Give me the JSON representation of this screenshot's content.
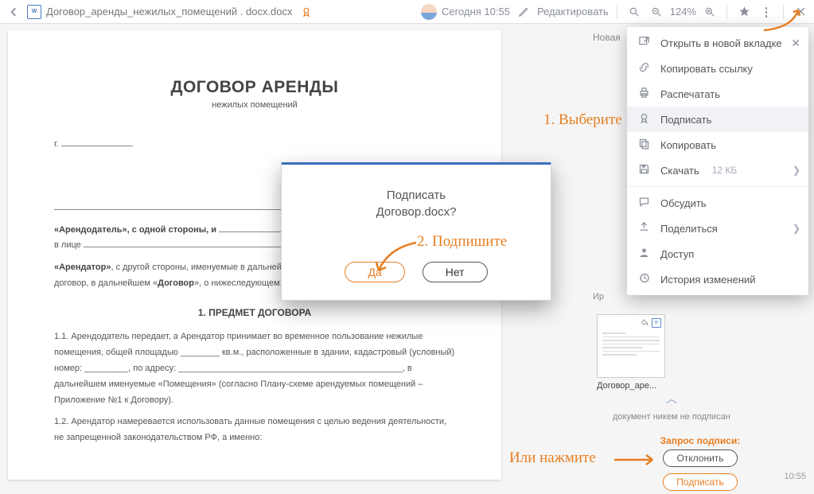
{
  "toolbar": {
    "doc_icon_text": "W",
    "title": "Договор_аренды_нежилых_помещений . docx.docx",
    "timestamp": "Сегодня 10:55",
    "edit_label": "Редактировать",
    "zoom": "124%"
  },
  "document": {
    "title": "ДОГОВОР АРЕНДЫ",
    "subtitle": "нежилых помещений",
    "city_prefix": "г.",
    "p1_a": "«Арендодатель», с одной стороны, и",
    "p1_b": "в лице",
    "p2": "«Арендатор», с другой стороны, именуемые в дальнейшем «Стороны», заключили настоящий договор, в дальнейшем «Договор», о нижеследующем:",
    "section1": "1. ПРЕДМЕТ ДОГОВОРА",
    "p3": "1.1. Арендодатель передает, а Арендатор принимает во временное пользование нежилые помещения, общей площадью ________ кв.м., расположенные в здании, кадастровый (условный) номер: _________, по адресу: ______________________________________________, в дальнейшем именуемые «Помещения» (согласно Плану-схеме арендуемых помещений – Приложение №1 к Договору).",
    "p4": "1.2. Арендатор намеревается использовать данные помещения с целью ведения деятельности, не запрещенной законодательством РФ, а именно:"
  },
  "dropdown": {
    "open_new_tab": "Открыть в новой вкладке",
    "copy_link": "Копировать ссылку",
    "print": "Распечатать",
    "sign": "Подписать",
    "copy": "Копировать",
    "download": "Скачать",
    "download_size": "12 КБ",
    "discuss": "Обсудить",
    "share": "Поделиться",
    "access": "Доступ",
    "history": "История изменений"
  },
  "modal": {
    "line1": "Подписать",
    "line2": "Договор.docx?",
    "yes": "Да",
    "no": "Нет"
  },
  "right": {
    "new_version": "Новая",
    "author_prefix": "Ир",
    "thumb_name": "Договор_аре...",
    "not_signed": "документ никем не подписан",
    "request_label": "Запрос подписи:",
    "reject": "Отклонить",
    "sign": "Подписать",
    "time": "10:55",
    "thumb_icon_text": "W"
  },
  "annotations": {
    "a1": "1. Выберите",
    "a2": "2. Подпишите",
    "a3": "Или нажмите"
  }
}
